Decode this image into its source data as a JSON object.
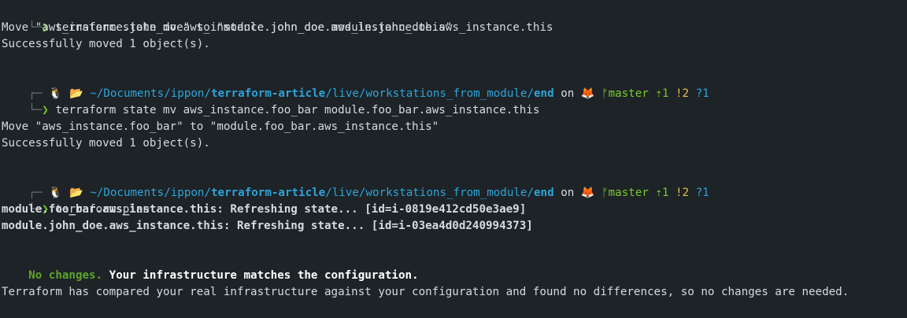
{
  "prompt": {
    "prefix": "─",
    "chevron": "❯",
    "corner_top": "┌─",
    "corner_bottom": "└─",
    "os_icon": "🐧",
    "folder_icon": "📂",
    "path_prefix": "~/Documents/ippon/",
    "path_repo": "terraform-article",
    "path_mid": "/live/workstations_from_module/",
    "path_last": "end",
    "on_word": "on",
    "gitlab_icon": "🦊",
    "branch_icon": "",
    "branch": "master",
    "ahead": "⇡1",
    "modified": "!2",
    "untracked": "?1"
  },
  "lines": {
    "cmd1": "terraform state mv aws_instance.john_doe module.john_doe.aws_instance.this",
    "out1a": "Move \"aws_instance.john_doe\" to \"module.john_doe.aws_instance.this\"",
    "out1b": "Successfully moved 1 object(s).",
    "cmd2": "terraform state mv aws_instance.foo_bar module.foo_bar.aws_instance.this",
    "out2a": "Move \"aws_instance.foo_bar\" to \"module.foo_bar.aws_instance.this\"",
    "out2b": "Successfully moved 1 object(s).",
    "cmd3": "terraform plan",
    "out3a": "module.foo_bar.aws_instance.this: Refreshing state... [id=i-0819e412cd50e3ae9]",
    "out3b": "module.john_doe.aws_instance.this: Refreshing state... [id=i-03ea4d0d240994373]",
    "nochanges": "No changes.",
    "matches": " Your infrastructure matches the configuration.",
    "final": "Terraform has compared your real infrastructure against your configuration and found no differences, so no changes are needed."
  },
  "colors": {
    "background": "#1d2327",
    "text": "#d6dbdf",
    "accent_green": "#7cc82a",
    "path_blue": "#2ea4d8",
    "modified_yellow": "#e3c341"
  }
}
